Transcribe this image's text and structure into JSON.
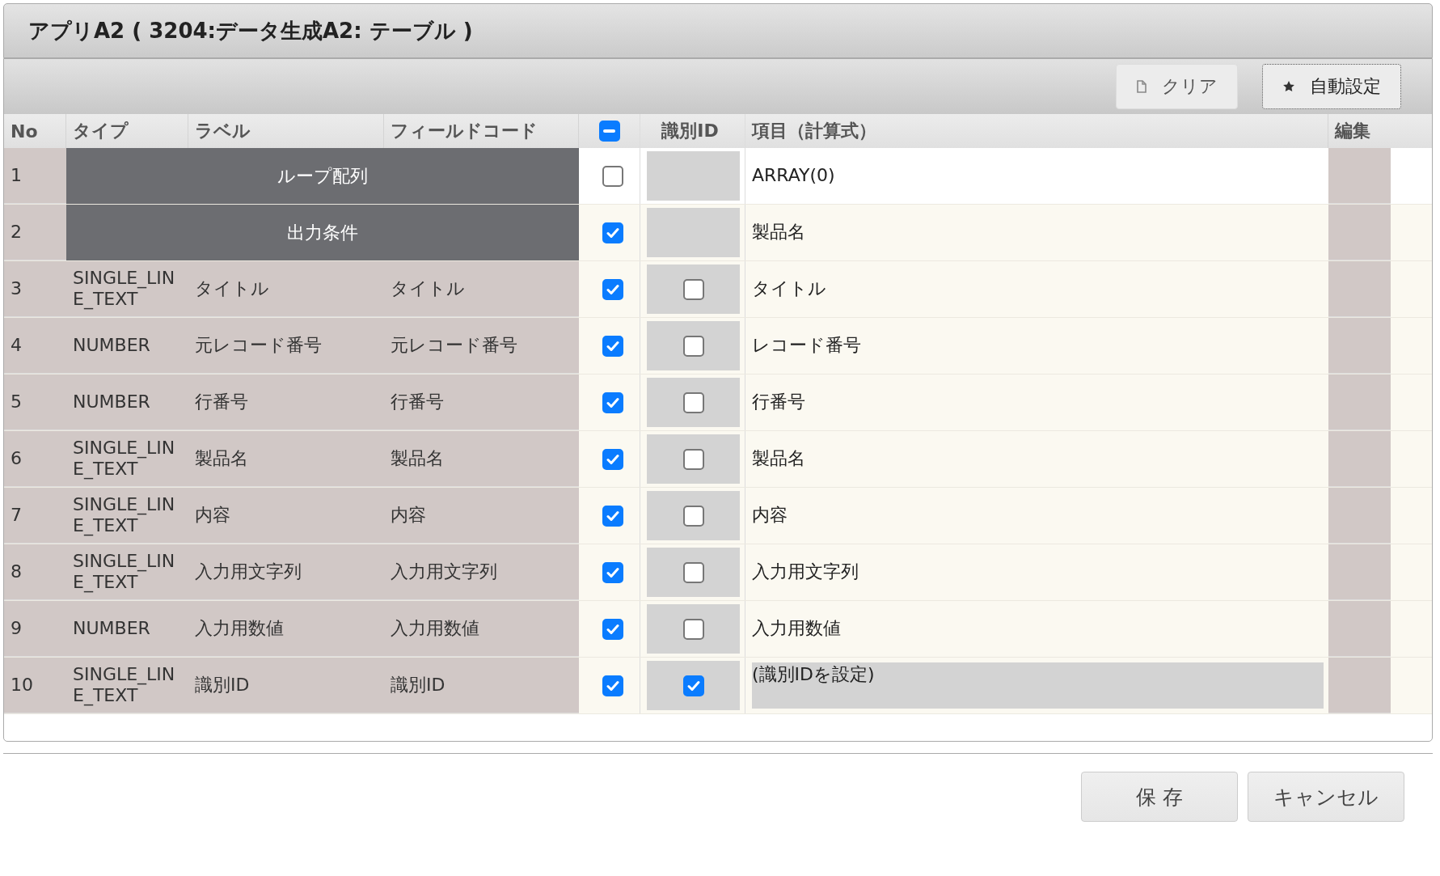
{
  "window": {
    "title": "アプリA2 ( 3204:データ生成A2: テーブル )"
  },
  "toolbar": {
    "buttons": [
      {
        "label": "クリア",
        "kind": "file",
        "focused": false
      },
      {
        "label": "自動設定",
        "kind": "star",
        "focused": true
      }
    ]
  },
  "table": {
    "columns": [
      "No",
      "タイプ",
      "ラベル",
      "フィールドコード",
      "識別ID",
      "項目（計算式）",
      "編集"
    ],
    "header_checkbox": {
      "indeterminate": true
    },
    "rows": [
      {
        "no": "1",
        "kind": "group",
        "title": "ループ配列",
        "checked": false,
        "item": "ARRAY(0)",
        "item_locked": false
      },
      {
        "no": "2",
        "kind": "group",
        "title": "出力条件",
        "checked": true,
        "item": "製品名",
        "item_locked": false
      },
      {
        "no": "3",
        "kind": "field",
        "type": "SINGLE_LINE_TEXT",
        "label": "タイトル",
        "code": "タイトル",
        "checked": true,
        "id_checked": false,
        "item": "タイトル",
        "item_locked": false
      },
      {
        "no": "4",
        "kind": "field",
        "type": "NUMBER",
        "label": "元レコード番号",
        "code": "元レコード番号",
        "checked": true,
        "id_checked": false,
        "item": "レコード番号",
        "item_locked": false
      },
      {
        "no": "5",
        "kind": "field",
        "type": "NUMBER",
        "label": "行番号",
        "code": "行番号",
        "checked": true,
        "id_checked": false,
        "item": "行番号",
        "item_locked": false
      },
      {
        "no": "6",
        "kind": "field",
        "type": "SINGLE_LINE_TEXT",
        "label": "製品名",
        "code": "製品名",
        "checked": true,
        "id_checked": false,
        "item": "製品名",
        "item_locked": false
      },
      {
        "no": "7",
        "kind": "field",
        "type": "SINGLE_LINE_TEXT",
        "label": "内容",
        "code": "内容",
        "checked": true,
        "id_checked": false,
        "item": "内容",
        "item_locked": false
      },
      {
        "no": "8",
        "kind": "field",
        "type": "SINGLE_LINE_TEXT",
        "label": "入力用文字列",
        "code": "入力用文字列",
        "checked": true,
        "id_checked": false,
        "item": "入力用文字列",
        "item_locked": false
      },
      {
        "no": "9",
        "kind": "field",
        "type": "NUMBER",
        "label": "入力用数値",
        "code": "入力用数値",
        "checked": true,
        "id_checked": false,
        "item": "入力用数値",
        "item_locked": false
      },
      {
        "no": "10",
        "kind": "field",
        "type": "SINGLE_LINE_TEXT",
        "label": "識別ID",
        "code": "識別ID",
        "checked": true,
        "id_checked": true,
        "item": "(識別IDを設定)",
        "item_locked": true
      }
    ]
  },
  "footer": {
    "buttons": [
      "保 存",
      "キャンセル"
    ]
  }
}
